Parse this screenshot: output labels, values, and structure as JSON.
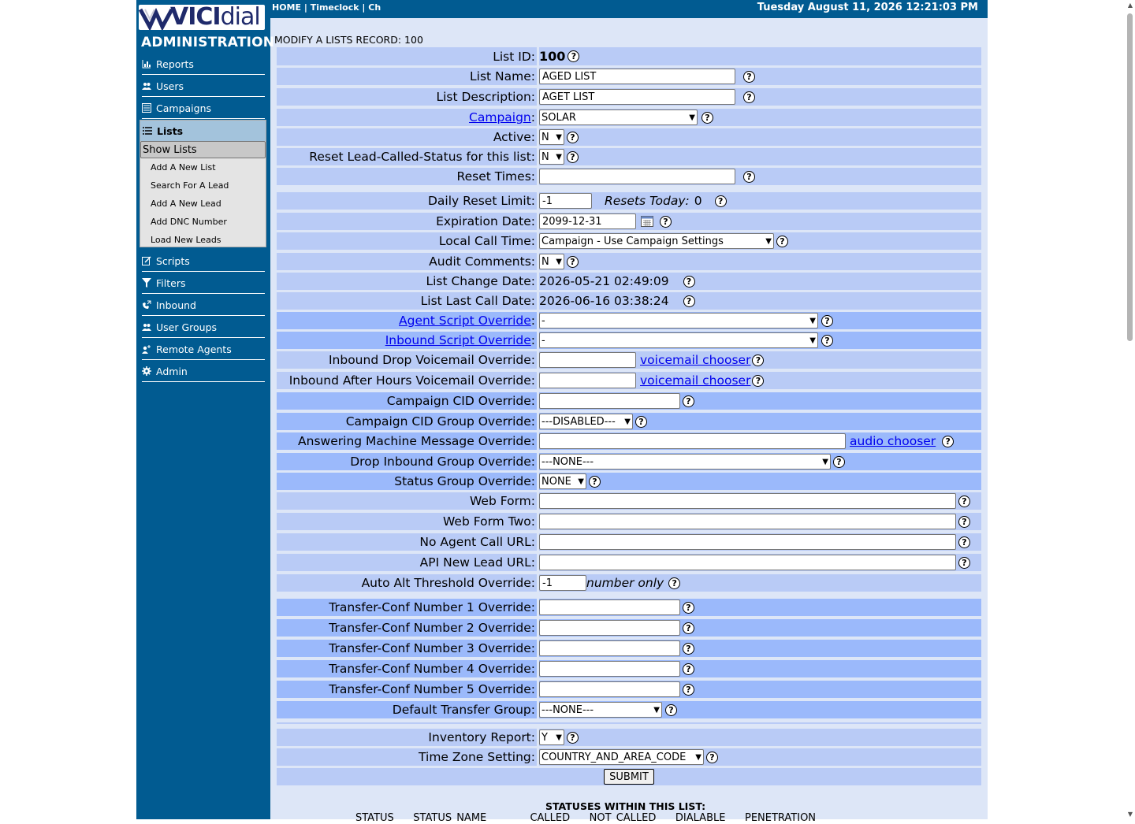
{
  "header": {
    "nav_links": "HOME | Timeclock | Ch",
    "datetime": "Tuesday August 11, 2026 12:21:03 PM"
  },
  "sidebar": {
    "logo_text_bold": "VICI",
    "logo_text": "dial",
    "title": "ADMINISTRATION",
    "items_top": [
      {
        "label": "Reports",
        "icon": "chart-icon"
      },
      {
        "label": "Users",
        "icon": "users-icon"
      },
      {
        "label": "Campaigns",
        "icon": "campaigns-icon"
      }
    ],
    "lists_label": "Lists",
    "lists_sub": [
      "Show Lists",
      "Add A New List",
      "Search For A Lead",
      "Add A New Lead",
      "Add DNC Number",
      "Load New Leads"
    ],
    "items_bottom": [
      {
        "label": "Scripts",
        "icon": "scripts-icon"
      },
      {
        "label": "Filters",
        "icon": "filter-icon"
      },
      {
        "label": "Inbound",
        "icon": "phone-icon"
      },
      {
        "label": "User Groups",
        "icon": "users-icon"
      },
      {
        "label": "Remote Agents",
        "icon": "remote-agent-icon"
      },
      {
        "label": "Admin",
        "icon": "gear-icon"
      }
    ]
  },
  "main": {
    "title": "MODIFY A LISTS RECORD: 100",
    "list_id_label": "List ID:",
    "list_id": "100",
    "list_name_label": "List Name:",
    "list_name": "AGED LIST",
    "list_desc_label": "List Description:",
    "list_desc": "AGET LIST",
    "campaign_label": "Campaign",
    "campaign": "SOLAR",
    "active_label": "Active:",
    "active": "N",
    "reset_status_label": "Reset Lead-Called-Status for this list:",
    "reset_status": "N",
    "reset_times_label": "Reset Times:",
    "reset_times": "",
    "daily_reset_label": "Daily Reset Limit:",
    "daily_reset": "-1",
    "resets_today_label": "Resets Today:",
    "resets_today": "0",
    "expiration_label": "Expiration Date:",
    "expiration": "2099-12-31",
    "local_call_time_label": "Local Call Time:",
    "local_call_time": "Campaign - Use Campaign Settings",
    "audit_comments_label": "Audit Comments:",
    "audit_comments": "N",
    "list_change_date_label": "List Change Date:",
    "list_change_date": "2026-05-21 02:49:09",
    "list_last_call_label": "List Last Call Date:",
    "list_last_call": "2026-06-16 03:38:24",
    "agent_script_label": "Agent Script Override",
    "agent_script": "-",
    "inbound_script_label": "Inbound Script Override",
    "inbound_script": "-",
    "drop_vm_label": "Inbound Drop Voicemail Override:",
    "after_hours_vm_label": "Inbound After Hours Voicemail Override:",
    "vm_chooser": "voicemail chooser",
    "cid_label": "Campaign CID Override:",
    "cid_group_label": "Campaign CID Group Override:",
    "cid_group": "---DISABLED---",
    "am_message_label": "Answering Machine Message Override:",
    "audio_chooser": "audio chooser",
    "drop_ingroup_label": "Drop Inbound Group Override:",
    "drop_ingroup": "---NONE---",
    "status_group_label": "Status Group Override:",
    "status_group": "NONE",
    "web_form_label": "Web Form:",
    "web_form_two_label": "Web Form Two:",
    "no_agent_url_label": "No Agent Call URL:",
    "api_new_lead_label": "API New Lead URL:",
    "auto_alt_label": "Auto Alt Threshold Override:",
    "auto_alt": "-1",
    "number_only": "number only",
    "xfer_labels": [
      "Transfer-Conf Number 1 Override:",
      "Transfer-Conf Number 2 Override:",
      "Transfer-Conf Number 3 Override:",
      "Transfer-Conf Number 4 Override:",
      "Transfer-Conf Number 5 Override:"
    ],
    "default_xfer_label": "Default Transfer Group:",
    "default_xfer": "---NONE---",
    "inventory_label": "Inventory Report:",
    "inventory": "Y",
    "tz_label": "Time Zone Setting:",
    "tz": "COUNTRY_AND_AREA_CODE",
    "submit": "SUBMIT",
    "statuses_title": "STATUSES WITHIN THIS LIST:",
    "status_columns": "STATUS    STATUS NAME         CALLED    NOT CALLED    DIALABLE    PENETRATION"
  }
}
